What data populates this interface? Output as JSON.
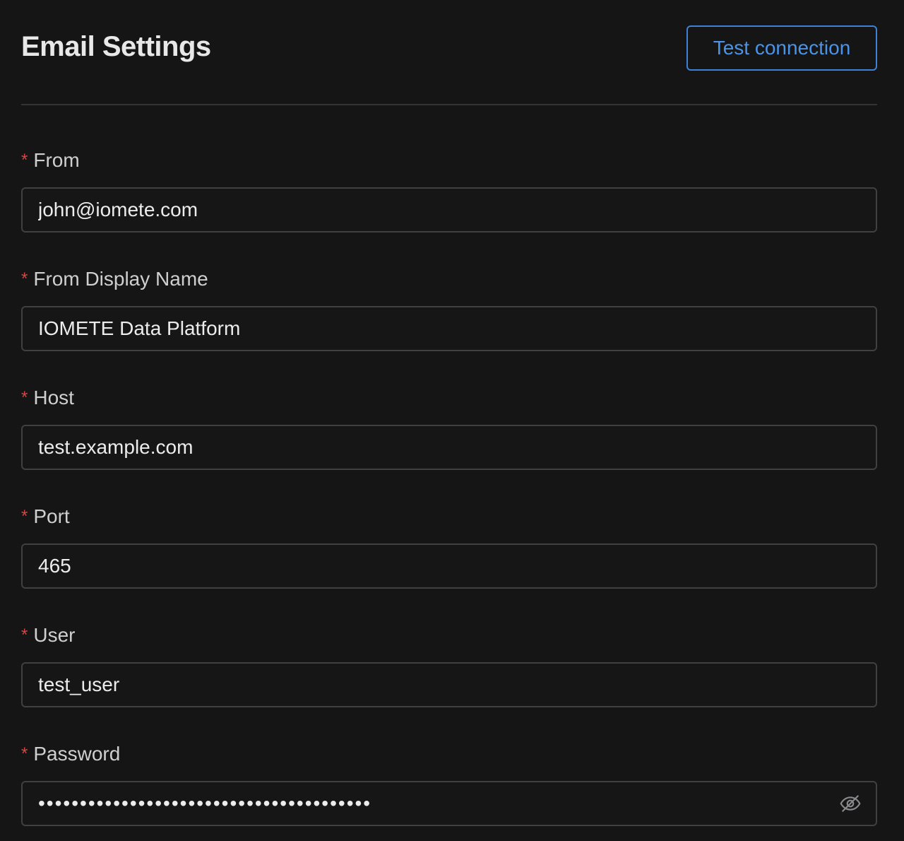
{
  "header": {
    "title": "Email Settings",
    "test_button_label": "Test connection"
  },
  "fields": {
    "from": {
      "label": "From",
      "value": "john@iomete.com",
      "required": true
    },
    "from_display_name": {
      "label": "From Display Name",
      "value": "IOMETE Data Platform",
      "required": true
    },
    "host": {
      "label": "Host",
      "value": "test.example.com",
      "required": true
    },
    "port": {
      "label": "Port",
      "value": "465",
      "required": true
    },
    "user": {
      "label": "User",
      "value": "test_user",
      "required": true
    },
    "password": {
      "label": "Password",
      "value": "••••••••••••••••••••••••••••••••••••••••",
      "required": true
    }
  },
  "required_marker": "*",
  "icons": {
    "password_toggle": "eye-slash-icon"
  },
  "colors": {
    "background": "#151516",
    "accent": "#4b93e6",
    "required": "#d9463f",
    "input_border": "#404043"
  }
}
